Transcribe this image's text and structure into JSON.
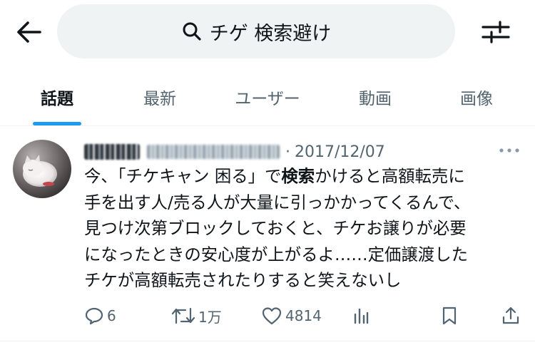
{
  "search": {
    "query": "チゲ 検索避け"
  },
  "tabs": [
    {
      "label": "話題",
      "active": true
    },
    {
      "label": "最新",
      "active": false
    },
    {
      "label": "ユーザー",
      "active": false
    },
    {
      "label": "動画",
      "active": false
    },
    {
      "label": "画像",
      "active": false
    }
  ],
  "tweet": {
    "date": "2017/12/07",
    "separator": "·",
    "lines": {
      "l1_a": "今、「チケキャン 困る」で",
      "l1_b": "検索",
      "l1_c": "かけると高額転売に",
      "l2": "手を出す人/売る人が大量に引っかかってくるんで、",
      "l3": "見つけ次第ブロックしておくと、チケお譲りが必要",
      "l4": "になったときの安心度が上がるよ……定価譲渡した",
      "l5": "チケが高額転売されたりすると笑えないし"
    },
    "counts": {
      "replies": "6",
      "retweets": "1万",
      "likes": "4814"
    }
  },
  "colors": {
    "accent": "#1d9bf0",
    "text": "#0f1419",
    "secondary": "#536471",
    "search_bg": "#eff3f4"
  },
  "icons": [
    "back-arrow-icon",
    "search-icon",
    "filter-sliders-icon",
    "more-dots-icon",
    "reply-icon",
    "retweet-icon",
    "like-icon",
    "views-icon",
    "bookmark-icon",
    "share-icon"
  ]
}
